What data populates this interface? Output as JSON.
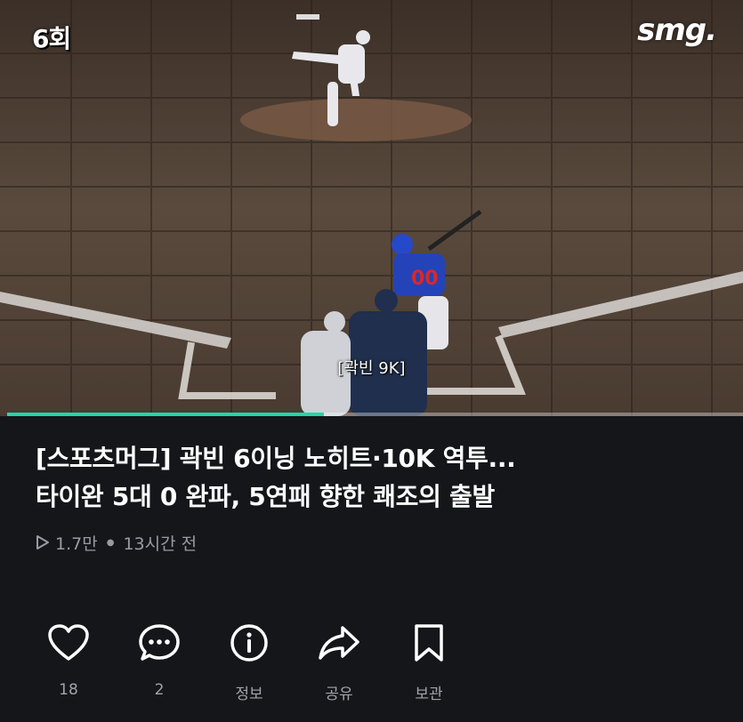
{
  "video": {
    "inning_badge": "6회",
    "brand_logo": "smg.",
    "caption": "[곽빈 9K]",
    "progress": 0.43,
    "colors": {
      "progress": "#23d6a8"
    }
  },
  "title_lines": [
    "[스포츠머그] 곽빈 6이닝 노히트·10K 역투...",
    "타이완 5대 0 완파, 5연패 향한 쾌조의 출발"
  ],
  "meta": {
    "views": "1.7만",
    "time_ago": "13시간 전"
  },
  "actions": [
    {
      "name": "like",
      "icon": "heart-icon",
      "label": "18"
    },
    {
      "name": "comment",
      "icon": "comment-icon",
      "label": "2"
    },
    {
      "name": "info",
      "icon": "info-icon",
      "label": "정보"
    },
    {
      "name": "share",
      "icon": "share-icon",
      "label": "공유"
    },
    {
      "name": "save",
      "icon": "bookmark-icon",
      "label": "보관"
    }
  ]
}
